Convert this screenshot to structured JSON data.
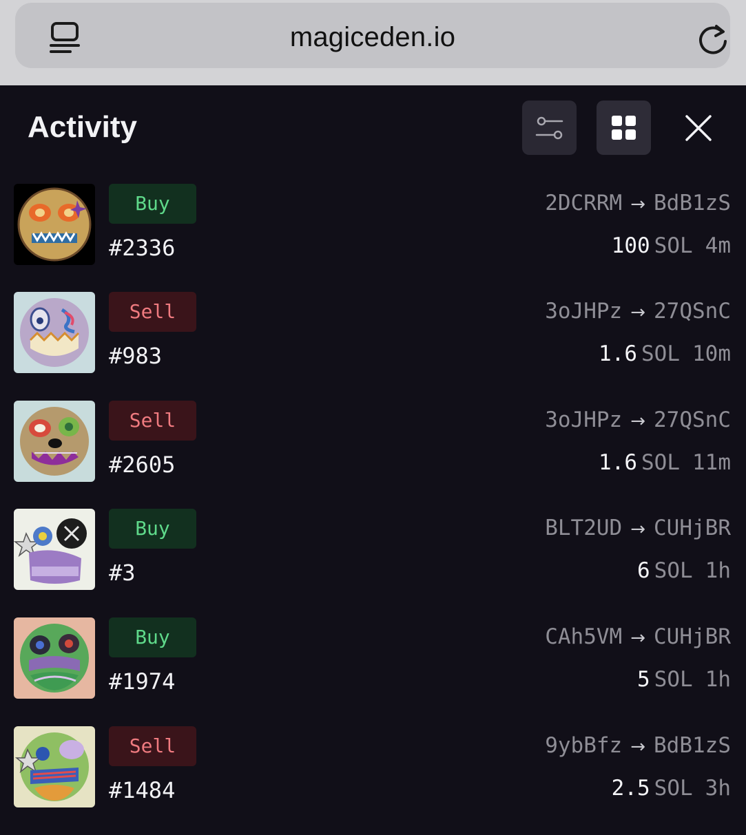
{
  "browser": {
    "url": "magiceden.io"
  },
  "header": {
    "title": "Activity"
  },
  "activity": [
    {
      "type": "Buy",
      "token": "#2336",
      "from": "2DCRRM",
      "to": "BdB1zS",
      "price": "100",
      "unit": "SOL",
      "age": "4m"
    },
    {
      "type": "Sell",
      "token": "#983",
      "from": "3oJHPz",
      "to": "27QSnC",
      "price": "1.6",
      "unit": "SOL",
      "age": "10m"
    },
    {
      "type": "Sell",
      "token": "#2605",
      "from": "3oJHPz",
      "to": "27QSnC",
      "price": "1.6",
      "unit": "SOL",
      "age": "11m"
    },
    {
      "type": "Buy",
      "token": "#3",
      "from": "BLT2UD",
      "to": "CUHjBR",
      "price": "6",
      "unit": "SOL",
      "age": "1h"
    },
    {
      "type": "Buy",
      "token": "#1974",
      "from": "CAh5VM",
      "to": "CUHjBR",
      "price": "5",
      "unit": "SOL",
      "age": "1h"
    },
    {
      "type": "Sell",
      "token": "#1484",
      "from": "9ybBfz",
      "to": "BdB1zS",
      "price": "2.5",
      "unit": "SOL",
      "age": "3h"
    }
  ],
  "colors": {
    "background": "#110f18",
    "buy_bg": "#12301f",
    "buy_text": "#5fd98a",
    "sell_bg": "#3a141a",
    "sell_text": "#f07b80"
  },
  "icons": {
    "reader": "reader-mode-icon",
    "reload": "reload-icon",
    "filter": "filter-sliders-icon",
    "grid": "grid-view-icon",
    "close": "close-icon",
    "arrow": "arrow-right-icon"
  }
}
